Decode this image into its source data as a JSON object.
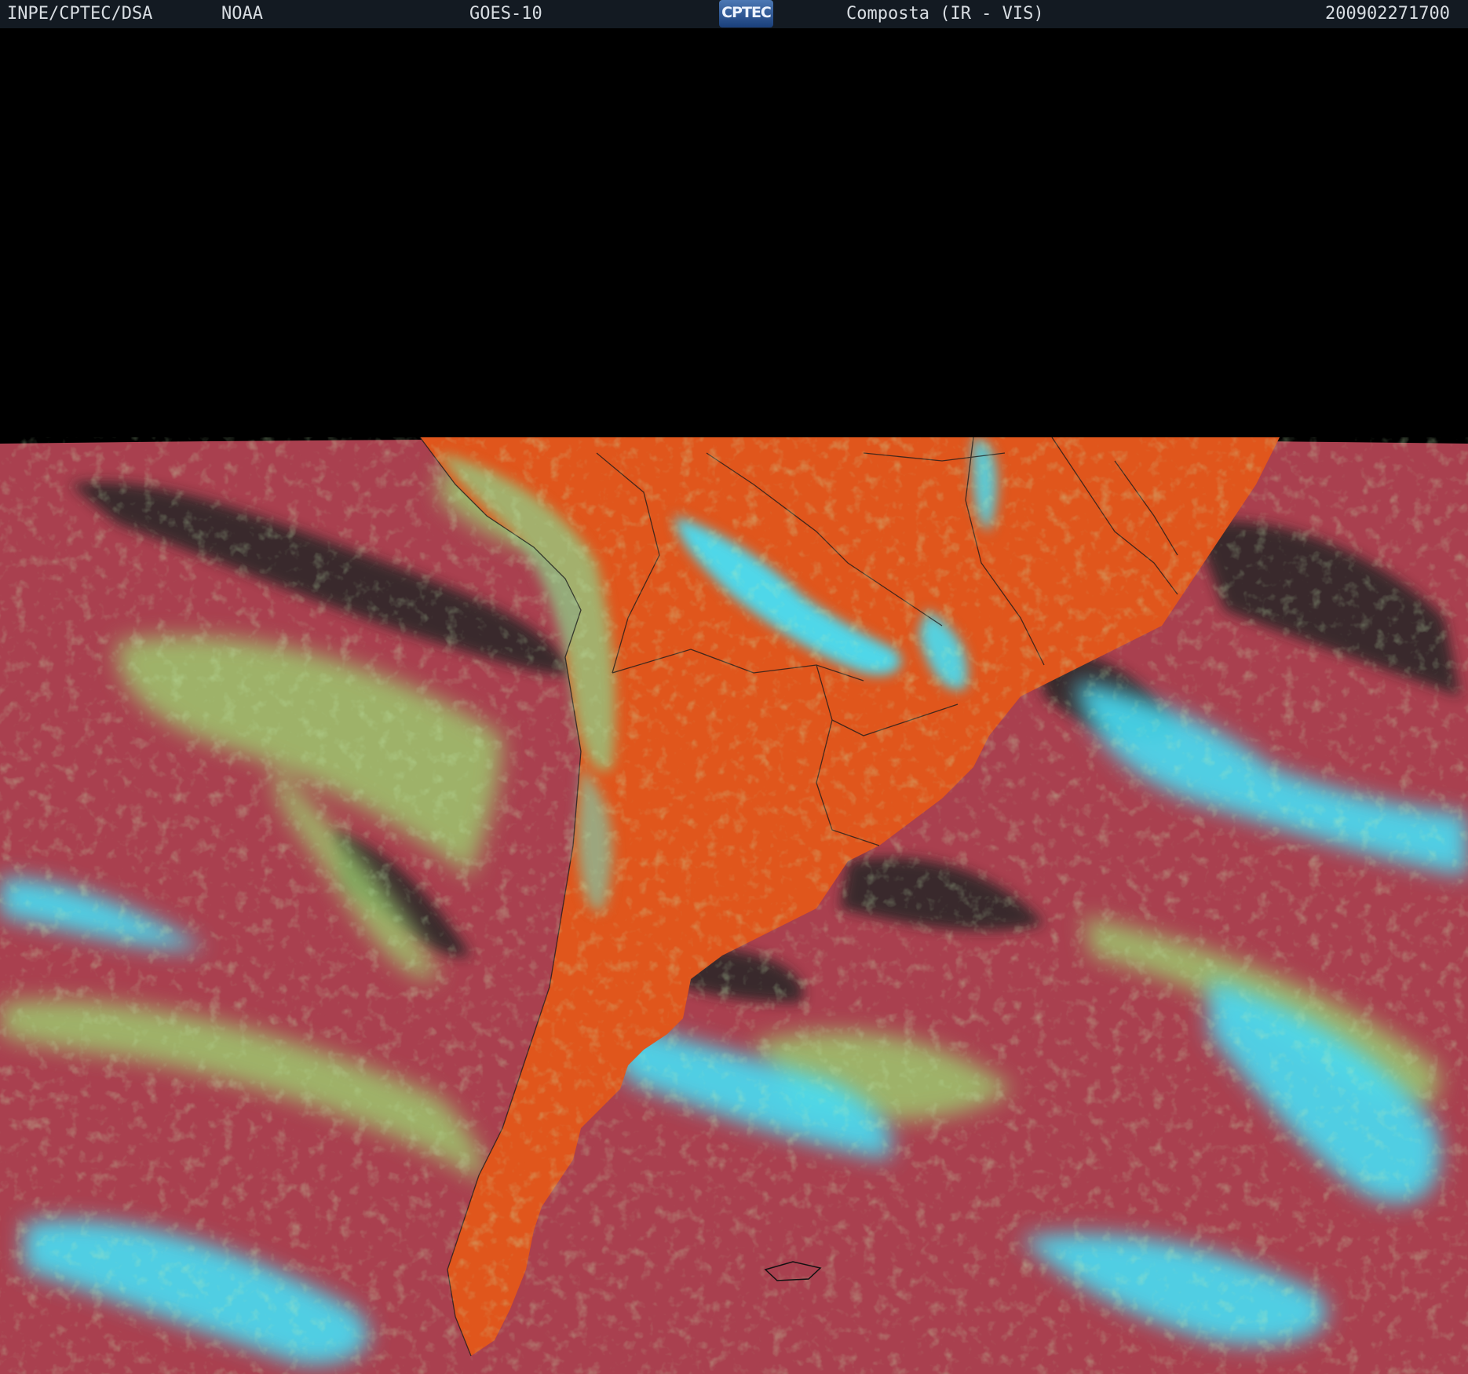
{
  "header": {
    "org": "INPE/CPTEC/DSA",
    "agency": "NOAA",
    "satellite": "GOES-10",
    "logo_text": "CPTEC",
    "product": "Composta (IR - VIS)",
    "timestamp": "200902271700"
  },
  "image": {
    "subject": "false-color IR/VIS composite satellite image of southern South America and surrounding oceans",
    "colors": {
      "ocean": "#a9404f",
      "land_clear": "#e0561c",
      "cloud_high": "#3ee3ff",
      "cloud_low": "#8fd07a",
      "clear_dark": "#222222",
      "space": "#000000"
    }
  }
}
